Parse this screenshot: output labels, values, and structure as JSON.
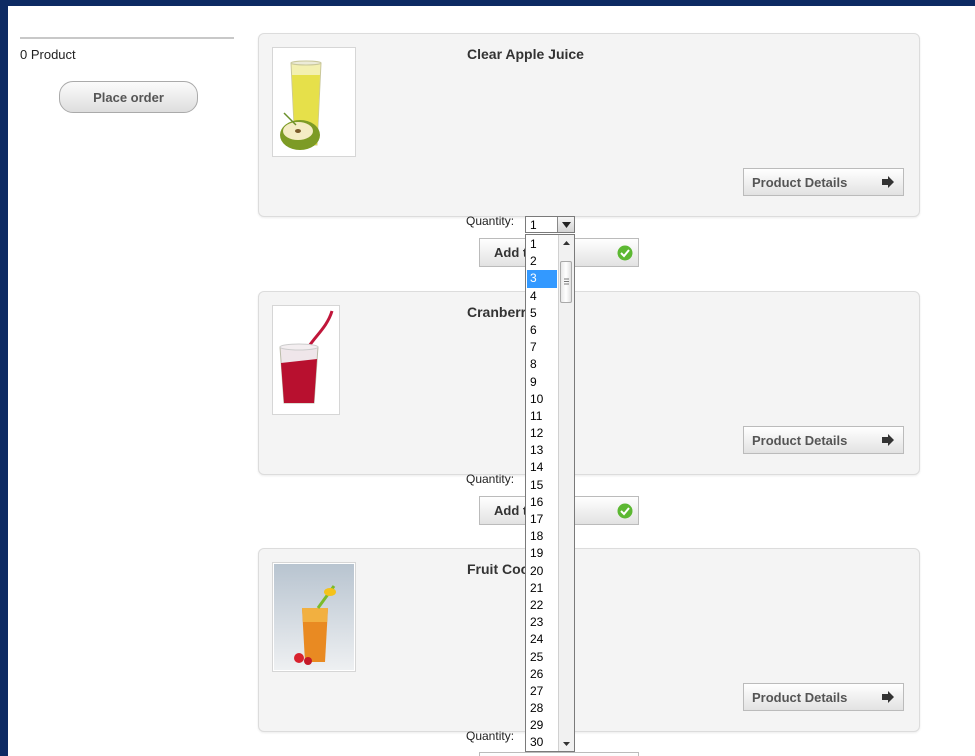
{
  "sidebar": {
    "cart_count": "0 Product",
    "place_order_label": "Place order"
  },
  "products": [
    {
      "title": "Clear Apple Juice",
      "details_label": "Product Details",
      "quantity_label": "Quantity:",
      "quantity_value": "1",
      "add_label": "Add to cart"
    },
    {
      "title": "Cranberry Juice",
      "details_label": "Product Details",
      "quantity_label": "Quantity:",
      "add_label": "Add to cart"
    },
    {
      "title": "Fruit Cocktail",
      "details_label": "Product Details",
      "quantity_label": "Quantity:"
    }
  ],
  "dropdown": {
    "options": [
      "1",
      "2",
      "3",
      "4",
      "5",
      "6",
      "7",
      "8",
      "9",
      "10",
      "11",
      "12",
      "13",
      "14",
      "15",
      "16",
      "17",
      "18",
      "19",
      "20",
      "21",
      "22",
      "23",
      "24",
      "25",
      "26",
      "27",
      "28",
      "29",
      "30"
    ],
    "selected": "3"
  },
  "colors": {
    "frame": "#0d2a63",
    "selection": "#3399ff",
    "ok_icon": "#5cb832"
  },
  "icons": [
    "arrow-right-icon",
    "checkmark-icon",
    "chevron-down-icon",
    "scroll-up-icon",
    "scroll-down-icon"
  ]
}
